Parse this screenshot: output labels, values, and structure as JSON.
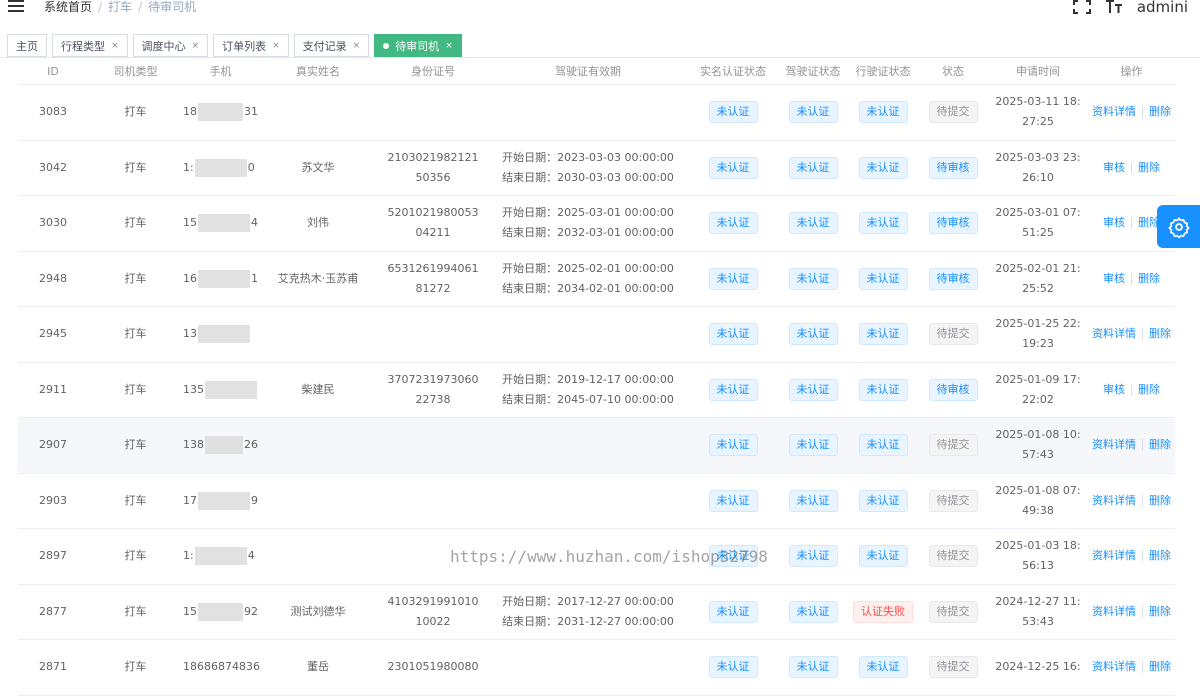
{
  "breadcrumb": {
    "home": "系统首页",
    "sep": "/",
    "level1": "打车",
    "level2": "待审司机"
  },
  "user": {
    "name": "admini"
  },
  "icons": {
    "menu": "hamburger-icon",
    "fullscreen": "fullscreen-icon",
    "size": "font-size-icon",
    "settings": "gear-icon",
    "close": "close-icon"
  },
  "tags": [
    {
      "label": "主页",
      "closable": false,
      "active": false
    },
    {
      "label": "行程类型",
      "closable": true,
      "active": false
    },
    {
      "label": "调度中心",
      "closable": true,
      "active": false
    },
    {
      "label": "订单列表",
      "closable": true,
      "active": false
    },
    {
      "label": "支付记录",
      "closable": true,
      "active": false
    },
    {
      "label": "待审司机",
      "closable": true,
      "active": true
    }
  ],
  "tag_close": "×",
  "columns": [
    "ID",
    "司机类型",
    "手机",
    "真实姓名",
    "身份证号",
    "驾驶证有效期",
    "实名认证状态",
    "驾驶证状态",
    "行驶证状态",
    "状态",
    "申请时间",
    "操作"
  ],
  "rows": [
    {
      "id": "3083",
      "type": "打车",
      "phone_pre": "18",
      "phone_suf": "31",
      "name": "",
      "idno1": "",
      "idno2": "",
      "start": "",
      "end": "",
      "realname": "未认证",
      "license": "未认证",
      "vehicle": "未认证",
      "vehicle_status": "blue",
      "status": "待提交",
      "status_style": "gray",
      "time1": "2025-03-11 18:",
      "time2": "27:25",
      "op1": "资料详情",
      "op2": "删除",
      "hl": false
    },
    {
      "id": "3042",
      "type": "打车",
      "phone_pre": "1:",
      "phone_suf": "0",
      "name": "苏文华",
      "idno1": "2103021982121",
      "idno2": "50356",
      "start": "开始日期：2023-03-03 00:00:00",
      "end": "结束日期：2030-03-03 00:00:00",
      "realname": "未认证",
      "license": "未认证",
      "vehicle": "未认证",
      "vehicle_status": "blue",
      "status": "待审核",
      "status_style": "blue",
      "time1": "2025-03-03 23:",
      "time2": "26:10",
      "op1": "审核",
      "op2": "删除",
      "hl": false
    },
    {
      "id": "3030",
      "type": "打车",
      "phone_pre": "15",
      "phone_suf": "4",
      "name": "刘伟",
      "idno1": "5201021980053",
      "idno2": "04211",
      "start": "开始日期：2025-03-01 00:00:00",
      "end": "结束日期：2032-03-01 00:00:00",
      "realname": "未认证",
      "license": "未认证",
      "vehicle": "未认证",
      "vehicle_status": "blue",
      "status": "待审核",
      "status_style": "blue",
      "time1": "2025-03-01 07:",
      "time2": "51:25",
      "op1": "审核",
      "op2": "删除",
      "hl": false
    },
    {
      "id": "2948",
      "type": "打车",
      "phone_pre": "16",
      "phone_suf": "1",
      "name": "艾克热木·玉苏甫",
      "idno1": "6531261994061",
      "idno2": "81272",
      "start": "开始日期：2025-02-01 00:00:00",
      "end": "结束日期：2034-02-01 00:00:00",
      "realname": "未认证",
      "license": "未认证",
      "vehicle": "未认证",
      "vehicle_status": "blue",
      "status": "待审核",
      "status_style": "blue",
      "time1": "2025-02-01 21:",
      "time2": "25:52",
      "op1": "审核",
      "op2": "删除",
      "hl": false
    },
    {
      "id": "2945",
      "type": "打车",
      "phone_pre": "13",
      "phone_suf": "",
      "name": "",
      "idno1": "",
      "idno2": "",
      "start": "",
      "end": "",
      "realname": "未认证",
      "license": "未认证",
      "vehicle": "未认证",
      "vehicle_status": "blue",
      "status": "待提交",
      "status_style": "gray",
      "time1": "2025-01-25 22:",
      "time2": "19:23",
      "op1": "资料详情",
      "op2": "删除",
      "hl": false
    },
    {
      "id": "2911",
      "type": "打车",
      "phone_pre": "135",
      "phone_suf": "",
      "name": "柴建民",
      "idno1": "3707231973060",
      "idno2": "22738",
      "start": "开始日期：2019-12-17 00:00:00",
      "end": "结束日期：2045-07-10 00:00:00",
      "realname": "未认证",
      "license": "未认证",
      "vehicle": "未认证",
      "vehicle_status": "blue",
      "status": "待审核",
      "status_style": "blue",
      "time1": "2025-01-09 17:",
      "time2": "22:02",
      "op1": "审核",
      "op2": "删除",
      "hl": false
    },
    {
      "id": "2907",
      "type": "打车",
      "phone_pre": "138",
      "phone_suf": "26",
      "name": "",
      "idno1": "",
      "idno2": "",
      "start": "",
      "end": "",
      "realname": "未认证",
      "license": "未认证",
      "vehicle": "未认证",
      "vehicle_status": "blue",
      "status": "待提交",
      "status_style": "gray",
      "time1": "2025-01-08 10:",
      "time2": "57:43",
      "op1": "资料详情",
      "op2": "删除",
      "hl": true
    },
    {
      "id": "2903",
      "type": "打车",
      "phone_pre": "17",
      "phone_suf": "9",
      "name": "",
      "idno1": "",
      "idno2": "",
      "start": "",
      "end": "",
      "realname": "未认证",
      "license": "未认证",
      "vehicle": "未认证",
      "vehicle_status": "blue",
      "status": "待提交",
      "status_style": "gray",
      "time1": "2025-01-08 07:",
      "time2": "49:38",
      "op1": "资料详情",
      "op2": "删除",
      "hl": false
    },
    {
      "id": "2897",
      "type": "打车",
      "phone_pre": "1:",
      "phone_suf": "4",
      "name": "",
      "idno1": "",
      "idno2": "",
      "start": "",
      "end": "",
      "realname": "未认证",
      "license": "未认证",
      "vehicle": "未认证",
      "vehicle_status": "blue",
      "status": "待提交",
      "status_style": "gray",
      "time1": "2025-01-03 18:",
      "time2": "56:13",
      "op1": "资料详情",
      "op2": "删除",
      "hl": false
    },
    {
      "id": "2877",
      "type": "打车",
      "phone_pre": "15",
      "phone_suf": "92",
      "name": "测试刘德华",
      "idno1": "4103291991010",
      "idno2": "10022",
      "start": "开始日期：2017-12-27 00:00:00",
      "end": "结束日期：2031-12-27 00:00:00",
      "realname": "未认证",
      "license": "未认证",
      "vehicle": "认证失败",
      "vehicle_status": "red",
      "status": "待提交",
      "status_style": "gray",
      "time1": "2024-12-27 11:",
      "time2": "53:43",
      "op1": "资料详情",
      "op2": "删除",
      "hl": false
    },
    {
      "id": "2871",
      "type": "打车",
      "phone_full": "18686874836",
      "phone_pre": "",
      "phone_suf": "",
      "name": "董岳",
      "idno1": "2301051980080",
      "idno2": "",
      "start": "",
      "end": "",
      "realname": "未认证",
      "license": "未认证",
      "vehicle": "未认证",
      "vehicle_status": "blue",
      "status": "待提交",
      "status_style": "gray",
      "time1": "2024-12-25 16:",
      "time2": "",
      "op1": "资料详情",
      "op2": "删除",
      "hl": false
    }
  ],
  "watermark": "https://www.huzhan.com/ishop32798",
  "colors": {
    "accent": "#1890ff",
    "active_tag": "#42b983",
    "danger": "#ff4949"
  }
}
